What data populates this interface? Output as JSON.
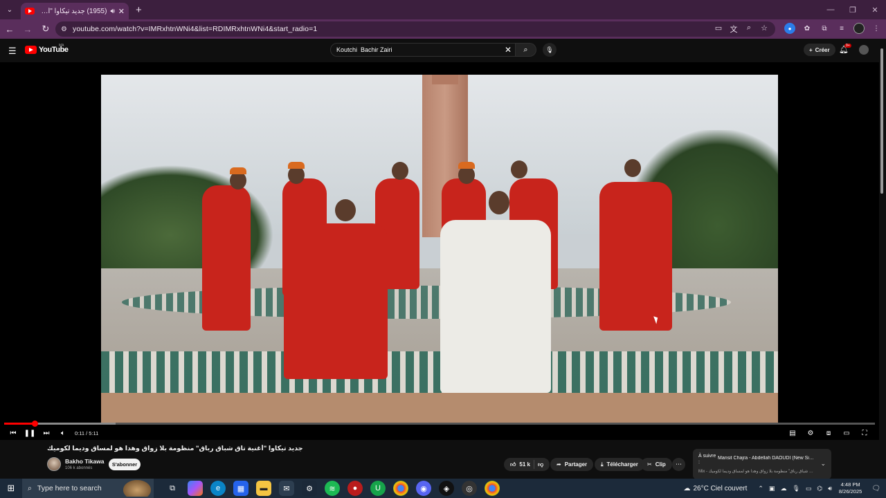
{
  "browser": {
    "tab_title": "(1955) جديد تيكاوا \"أغنية تاق",
    "url": "youtube.com/watch?v=IMRxhtnWNi4&list=RDIMRxhtnWNi4&start_radio=1",
    "icons": [
      "tab-search-icon",
      "audio-icon",
      "close-icon",
      "plus-icon",
      "back-icon",
      "forward-icon",
      "reload-icon",
      "site-info-icon",
      "cast-icon",
      "translate-icon",
      "zoom-icon",
      "star-icon",
      "extensions-icon",
      "profile-icon",
      "menu-dots-icon"
    ]
  },
  "youtube": {
    "logo_text": "YouTube",
    "region": "MA",
    "search_value": "Koutchi  Bachir Zairi",
    "create_label": "Créer",
    "notification_count": "9+"
  },
  "player": {
    "time": "0:11 / 5:11",
    "progress_fraction": 0.035,
    "buffer_fraction": 0.128
  },
  "video": {
    "title": "جديد تيكاوا \"أغنية تاق شباق رباق\" منظومة بلا زواق وهدا هو لمساق وديما لكوميك",
    "channel": "Bakho Tikawa",
    "subscribers": "106 k abonnés",
    "subscribe_label": "S'abonner",
    "likes": "51 k",
    "share_label": "Partager",
    "download_label": "Télécharger",
    "clip_label": "Clip"
  },
  "next_up": {
    "label": "À suivre :",
    "title": "Mansit Chajra - Abdellah DAOUDI (New Sin...",
    "subtitle": "Mix - جديد تيكاوا \"أغنية تاق شباق رباق\" منظومة بلا زواق وهدا هو لمساق وديما لكوميك"
  },
  "taskbar": {
    "search_placeholder": "Type here to search",
    "weather": "26°C  Ciel couvert",
    "time": "4:48 PM",
    "date": "8/26/2025"
  },
  "colors": {
    "tab_bg": "#3c1f3e",
    "toolbar_bg": "#5a2e5c",
    "yt_red": "#ff0000",
    "yt_bg": "#0f0f0f",
    "taskbar_bg": "#1c2a3a"
  }
}
